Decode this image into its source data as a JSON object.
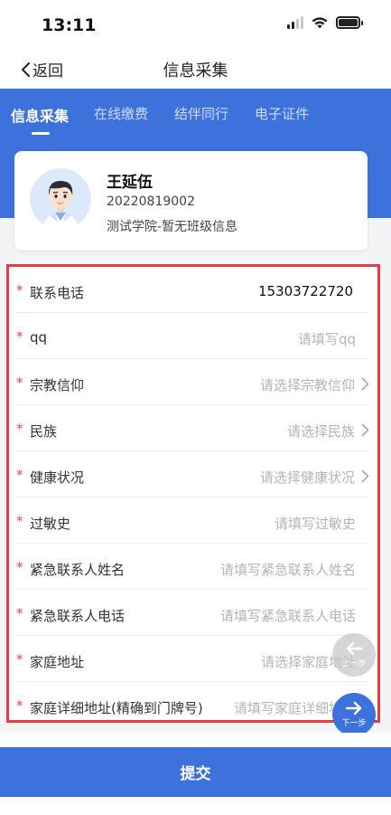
{
  "status_bar": {
    "time": "13:11",
    "icons": [
      "signal-icon",
      "wifi-icon",
      "battery-icon"
    ]
  },
  "nav": {
    "back_label": "返回",
    "title": "信息采集"
  },
  "tabs": [
    {
      "label": "信息采集",
      "active": true
    },
    {
      "label": "在线缴费",
      "active": false
    },
    {
      "label": "结伴同行",
      "active": false
    },
    {
      "label": "电子证件",
      "active": false
    }
  ],
  "profile": {
    "name": "王延伍",
    "student_id": "20220819002",
    "org": "测试学院-暂无班级信息"
  },
  "form": {
    "fields": [
      {
        "label": "联系电话",
        "value": "15303722720",
        "placeholder": "",
        "required": true,
        "has_arrow": false
      },
      {
        "label": "qq",
        "value": "",
        "placeholder": "请填写qq",
        "required": true,
        "has_arrow": false
      },
      {
        "label": "宗教信仰",
        "value": "",
        "placeholder": "请选择宗教信仰",
        "required": true,
        "has_arrow": true
      },
      {
        "label": "民族",
        "value": "",
        "placeholder": "请选择民族",
        "required": true,
        "has_arrow": true
      },
      {
        "label": "健康状况",
        "value": "",
        "placeholder": "请选择健康状况",
        "required": true,
        "has_arrow": true
      },
      {
        "label": "过敏史",
        "value": "",
        "placeholder": "请填写过敏史",
        "required": true,
        "has_arrow": false
      },
      {
        "label": "紧急联系人姓名",
        "value": "",
        "placeholder": "请填写紧急联系人姓名",
        "required": true,
        "has_arrow": false
      },
      {
        "label": "紧急联系人电话",
        "value": "",
        "placeholder": "请填写紧急联系人电话",
        "required": true,
        "has_arrow": false
      },
      {
        "label": "家庭地址",
        "value": "",
        "placeholder": "请选择家庭地址",
        "required": true,
        "has_arrow": false
      },
      {
        "label": "家庭详细地址(精确到门牌号)",
        "value": "",
        "placeholder": "请填写家庭详细地址",
        "required": true,
        "has_arrow": false
      }
    ]
  },
  "floating": {
    "prev_label": "上一步",
    "next_label": "下一步"
  },
  "submit_label": "提交",
  "colors": {
    "accent": "#3d71dc",
    "required_star": "#e0464a",
    "highlight_outline": "#e63a45"
  }
}
